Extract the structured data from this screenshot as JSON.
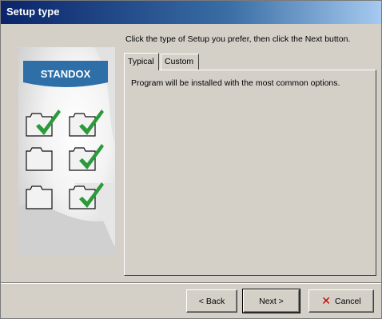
{
  "window": {
    "title": "Setup type"
  },
  "instruction": "Click the type of Setup you prefer, then click the Next button.",
  "brand": {
    "logo_text": "STANDOX",
    "logo_color": "#2e6fa8"
  },
  "tabs": [
    {
      "label": "Typical",
      "selected": true
    },
    {
      "label": "Custom",
      "selected": false
    }
  ],
  "tab_content": {
    "description": "Program will be installed with the most common options."
  },
  "buttons": {
    "back": "< Back",
    "next": "Next >",
    "cancel": "Cancel"
  },
  "colors": {
    "check": "#2a9a3a",
    "cancel_icon": "#c00000"
  }
}
